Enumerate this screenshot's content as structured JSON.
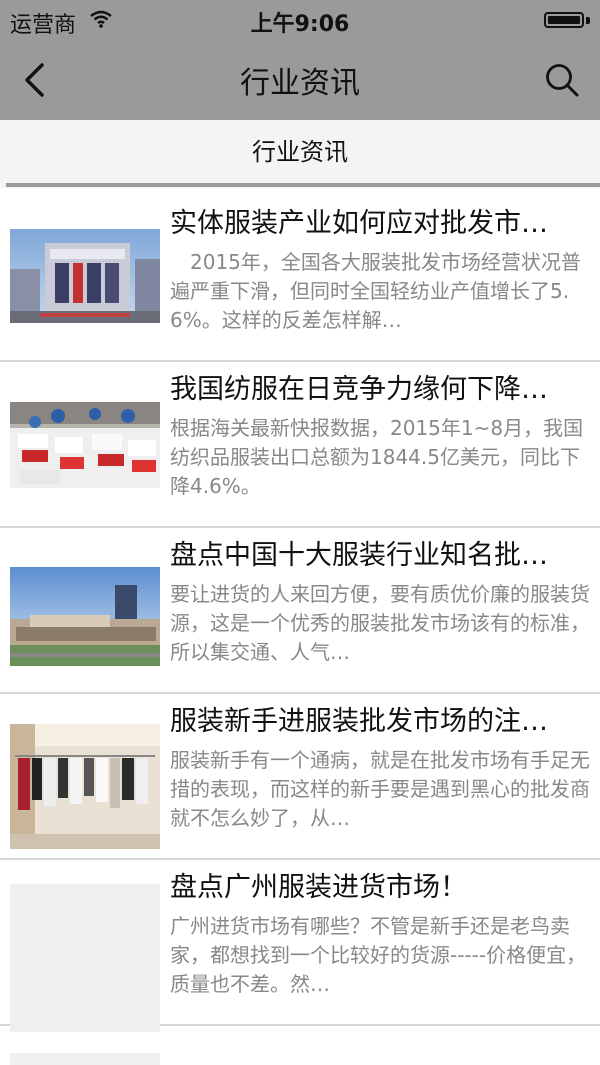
{
  "status_bar": {
    "carrier": "运营商",
    "time": "上午9:06",
    "icons": [
      "wifi-icon",
      "battery-icon"
    ]
  },
  "nav_bar": {
    "title": "行业资讯",
    "back_icon": "chevron-left-icon",
    "search_icon": "search-icon"
  },
  "tab": {
    "label": "行业资讯"
  },
  "articles": [
    {
      "title": "实体服装产业如何应对批发市…",
      "summary": "　2015年，全国各大服装批发市场经营状况普遍严重下滑，但同时全国轻纺业产值增长了5.6%。这样的反差怎样解…",
      "image": "building-photo"
    },
    {
      "title": "我国纺服在日竞争力缘何下降…",
      "summary": "根据海关最新快报数据，2015年1~8月，我国纺织品服装出口总额为1844.5亿美元，同比下降4.6%。",
      "image": "factory-photo"
    },
    {
      "title": "盘点中国十大服装行业知名批…",
      "summary": "要让进货的人来回方便，要有质优价廉的服装货源，这是一个优秀的服装批发市场该有的标准，所以集交通、人气…",
      "image": "market-complex-photo"
    },
    {
      "title": "服装新手进服装批发市场的注…",
      "summary": "服装新手有一个通病，就是在批发市场有手足无措的表现，而这样的新手要是遇到黑心的批发商就不怎么妙了，从…",
      "image": "clothing-rack-photo"
    },
    {
      "title": "盘点广州服装进货市场！",
      "summary": "广州进货市场有哪些？不管是新手还是老鸟卖家，都想找到一个比较好的货源-----价格便宜，质量也不差。然…",
      "image": "placeholder-image"
    }
  ]
}
